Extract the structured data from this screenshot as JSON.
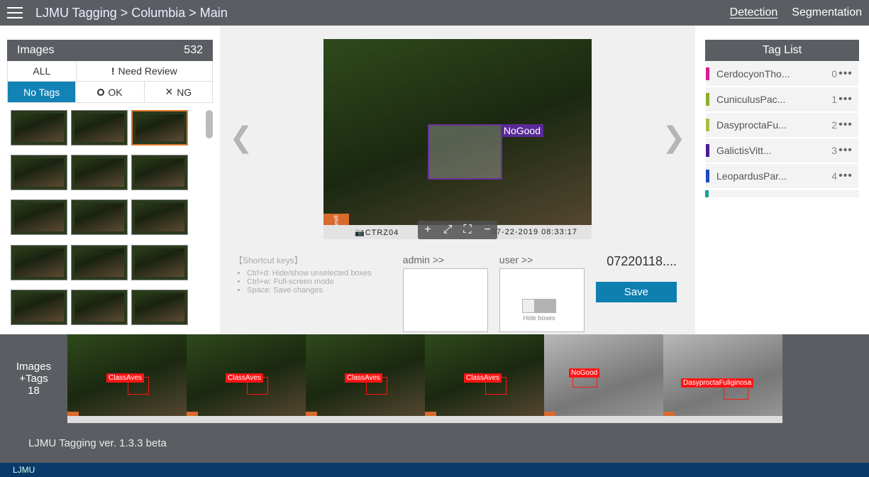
{
  "header": {
    "breadcrumb": "LJMU Tagging > Columbia > Main",
    "nav": {
      "detection": "Detection",
      "segmentation": "Segmentation"
    }
  },
  "images_panel": {
    "title": "Images",
    "count": "532",
    "filters": {
      "all": "ALL",
      "need_review": "Need Review",
      "no_tags": "No Tags",
      "ok": "OK",
      "ng": "NG"
    }
  },
  "viewer": {
    "bbox_label": "NoGood",
    "timestamp": "07-22-2019   08:33:17",
    "camcode": "📷CTRZ04",
    "brand": "Bushnell",
    "controls": {
      "zoom_in": "+",
      "fullscreen": "⛶",
      "fit": "⤢",
      "zoom_out": "−"
    }
  },
  "shortcuts": {
    "title": "【Shortcut keys】",
    "items": [
      "Ctrl+d: Hide/show unselected boxes",
      "Ctrl+w: Full-screen mode",
      "Space: Save changes"
    ]
  },
  "notes": {
    "admin_label": "admin >>",
    "user_label": "user >>"
  },
  "info": {
    "filename": "07220118....",
    "save": "Save",
    "hide_boxes": "Hide boxes"
  },
  "taglist": {
    "title": "Tag List",
    "tags": [
      {
        "name": "CerdocyonTho...",
        "key": "0",
        "color": "#d81b9a"
      },
      {
        "name": "CuniculusPac...",
        "key": "1",
        "color": "#8fae2a"
      },
      {
        "name": "DasyproctaFu...",
        "key": "2",
        "color": "#a7c043"
      },
      {
        "name": "GalictisVitt...",
        "key": "3",
        "color": "#4a1f8f"
      },
      {
        "name": "LeopardusPar...",
        "key": "4",
        "color": "#1c49c4"
      }
    ],
    "stub_color": "#17a39a"
  },
  "strip": {
    "label_line1": "Images",
    "label_line2": "+Tags",
    "count": "18",
    "items": [
      {
        "tag": "ClassAves",
        "night": false
      },
      {
        "tag": "ClassAves",
        "night": false
      },
      {
        "tag": "ClassAves",
        "night": false
      },
      {
        "tag": "ClassAves",
        "night": false
      },
      {
        "tag": "NoGood",
        "night": true
      },
      {
        "tag": "DasyproctaFuliginosa",
        "night": true
      }
    ]
  },
  "footer": {
    "version": "LJMU Tagging ver. 1.3.3 beta",
    "org": "LJMU"
  }
}
